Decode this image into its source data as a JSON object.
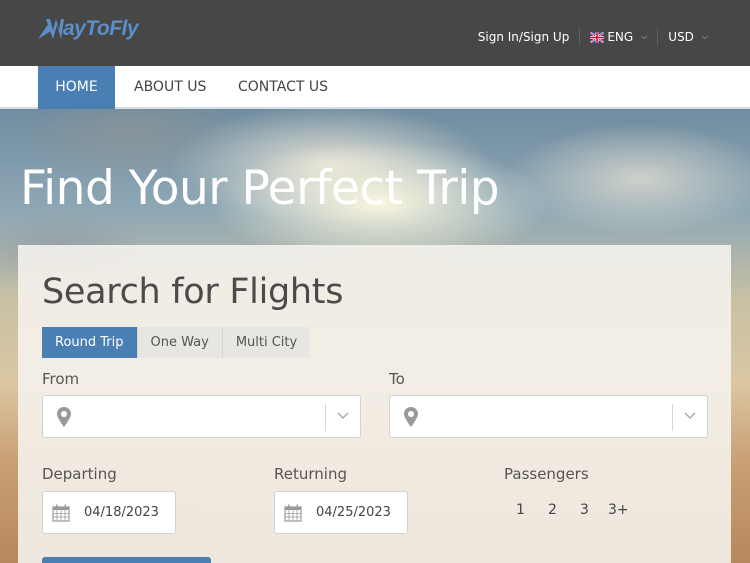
{
  "brand": {
    "name": "WayToFly",
    "logo_text": "ayToFly",
    "color": "#5a8fc8"
  },
  "top_links": {
    "signin": "Sign In/Sign Up",
    "language": "ENG",
    "language_icon": "uk-flag-icon",
    "currency": "USD"
  },
  "nav": {
    "items": [
      {
        "label": "HOME",
        "active": true
      },
      {
        "label": "ABOUT US",
        "active": false
      },
      {
        "label": "CONTACT US",
        "active": false
      }
    ]
  },
  "hero": {
    "title": "Find Your Perfect Trip"
  },
  "search": {
    "title": "Search for Flights",
    "trip_types": [
      {
        "label": "Round Trip",
        "active": true
      },
      {
        "label": "One Way",
        "active": false
      },
      {
        "label": "Multi City",
        "active": false
      }
    ],
    "from_label": "From",
    "to_label": "To",
    "from_value": "",
    "to_value": "",
    "departing_label": "Departing",
    "returning_label": "Returning",
    "departing_value": "04/18/2023",
    "returning_value": "04/25/2023",
    "passengers_label": "Passengers",
    "passenger_options": [
      "1",
      "2",
      "3",
      "3+"
    ]
  },
  "colors": {
    "accent": "#4a7fb4",
    "topbar": "#474747"
  }
}
